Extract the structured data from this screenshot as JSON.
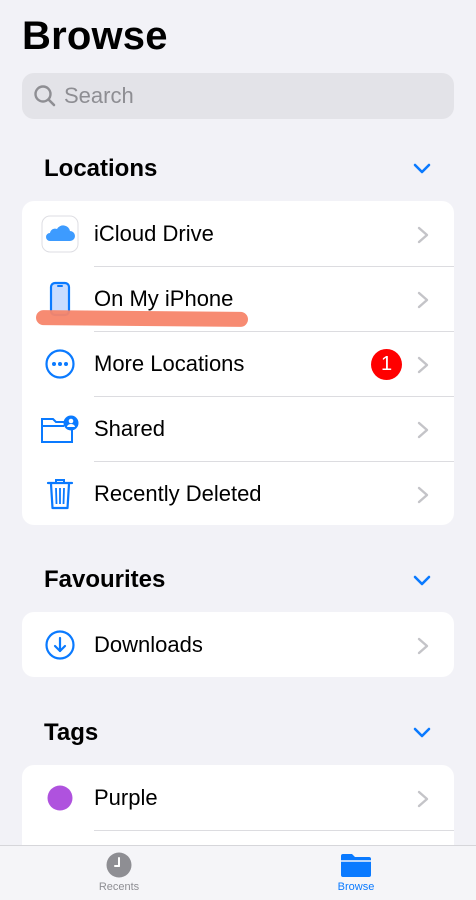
{
  "header": {
    "title": "Browse"
  },
  "search": {
    "placeholder": "Search"
  },
  "sections": {
    "locations": {
      "title": "Locations",
      "items": [
        {
          "label": "iCloud Drive",
          "icon": "icloud-icon"
        },
        {
          "label": "On My iPhone",
          "icon": "iphone-icon"
        },
        {
          "label": "More Locations",
          "icon": "ellipsis-circle-icon",
          "badge": "1"
        },
        {
          "label": "Shared",
          "icon": "shared-folder-icon"
        },
        {
          "label": "Recently Deleted",
          "icon": "trash-icon"
        }
      ]
    },
    "favourites": {
      "title": "Favourites",
      "items": [
        {
          "label": "Downloads",
          "icon": "download-circle-icon"
        }
      ]
    },
    "tags": {
      "title": "Tags",
      "items": [
        {
          "label": "Purple",
          "icon": "purple-tag-dot",
          "color": "#af52de"
        }
      ]
    }
  },
  "tabbar": {
    "tabs": [
      {
        "label": "Recents",
        "icon": "clock-icon",
        "selected": false
      },
      {
        "label": "Browse",
        "icon": "folder-icon",
        "selected": true
      }
    ]
  },
  "colors": {
    "accent": "#0a7aff",
    "badge": "#ff0000",
    "annotation": "#f7856a"
  }
}
